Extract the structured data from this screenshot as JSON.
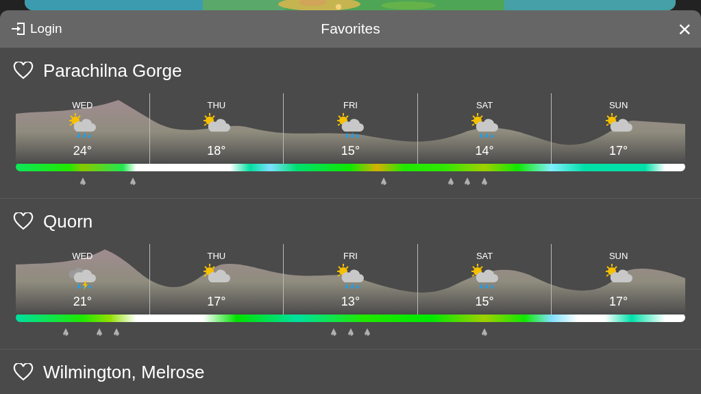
{
  "header": {
    "login": "Login",
    "title": "Favorites",
    "close": "×"
  },
  "locations": [
    {
      "name": "Parachilna Gorge",
      "days": [
        {
          "day": "WED",
          "kind": "sun-rain",
          "temp": "24°",
          "slots": [
            {
              "kind": "dry"
            },
            {
              "kind": "dry"
            },
            {
              "kind": "dry"
            },
            {
              "kind": "rain"
            },
            {
              "kind": "dry"
            },
            {
              "kind": "dry"
            },
            {
              "kind": "rain"
            },
            {
              "kind": "dry"
            }
          ]
        },
        {
          "day": "THU",
          "kind": "sun-cloud",
          "temp": "18°"
        },
        {
          "day": "FRI",
          "kind": "sun-rain",
          "temp": "15°",
          "slots": [
            {
              "kind": "dry"
            },
            {
              "kind": "dry"
            },
            {
              "kind": "dry"
            },
            {
              "kind": "dry"
            },
            {
              "kind": "dry"
            },
            {
              "kind": "rain"
            },
            {
              "kind": "dry"
            },
            {
              "kind": "dry"
            }
          ]
        },
        {
          "day": "SAT",
          "kind": "sun-rain",
          "temp": "14°",
          "slots": [
            {
              "kind": "dry"
            },
            {
              "kind": "rain"
            },
            {
              "kind": "rain"
            },
            {
              "kind": "rain"
            },
            {
              "kind": "dry"
            },
            {
              "kind": "dry"
            },
            {
              "kind": "dry"
            },
            {
              "kind": "dry"
            }
          ]
        },
        {
          "day": "SUN",
          "kind": "sun-cloud",
          "temp": "17°"
        }
      ]
    },
    {
      "name": "Quorn",
      "days": [
        {
          "day": "WED",
          "kind": "thunder-rain",
          "temp": "21°",
          "slots": [
            {
              "kind": "dry"
            },
            {
              "kind": "dry"
            },
            {
              "kind": "rain"
            },
            {
              "kind": "dry"
            },
            {
              "kind": "rain"
            },
            {
              "kind": "rain"
            },
            {
              "kind": "dry"
            },
            {
              "kind": "dry"
            }
          ]
        },
        {
          "day": "THU",
          "kind": "sun-cloud",
          "temp": "17°"
        },
        {
          "day": "FRI",
          "kind": "sun-rain",
          "temp": "13°",
          "slots": [
            {
              "kind": "dry"
            },
            {
              "kind": "dry"
            },
            {
              "kind": "rain"
            },
            {
              "kind": "rain"
            },
            {
              "kind": "rain"
            },
            {
              "kind": "dry"
            },
            {
              "kind": "dry"
            },
            {
              "kind": "dry"
            }
          ]
        },
        {
          "day": "SAT",
          "kind": "sun-rain",
          "temp": "15°",
          "slots": [
            {
              "kind": "dry"
            },
            {
              "kind": "dry"
            },
            {
              "kind": "dry"
            },
            {
              "kind": "rain"
            },
            {
              "kind": "dry"
            },
            {
              "kind": "dry"
            },
            {
              "kind": "dry"
            },
            {
              "kind": "dry"
            }
          ]
        },
        {
          "day": "SUN",
          "kind": "sun-cloud",
          "temp": "17°"
        }
      ]
    },
    {
      "name": "Wilmington, Melrose"
    }
  ]
}
